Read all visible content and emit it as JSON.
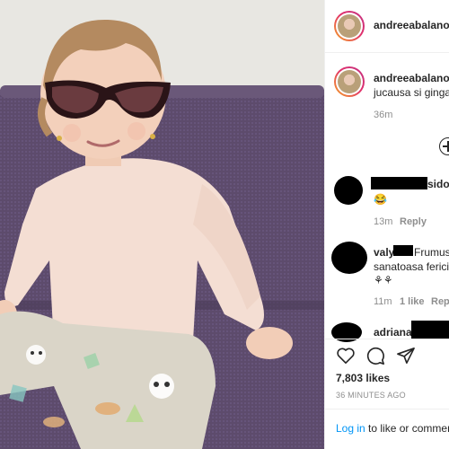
{
  "post": {
    "author": "andreeabalanoff",
    "caption_line": "jucausa si ginga",
    "caption_time": "36m",
    "likes": "7,803 likes",
    "time_ago": "36 MINUTES AGO",
    "login_link": "Log in",
    "login_suffix": " to like or comment"
  },
  "comments": [
    {
      "username_suffix": "sidor",
      "text": "😂",
      "time": "13m",
      "reply": "Reply"
    },
    {
      "username": "valy",
      "text_line1": "Frumuse",
      "text_line2": "sanatoasa fericita",
      "text_line3": "⚘⚘",
      "time": "11m",
      "likes": "1 like",
      "reply": "Reply"
    },
    {
      "username": "adrianac"
    }
  ],
  "colors": {
    "accent_link": "#0095f6",
    "sofa": "#5c4a6b",
    "wall": "#e7e6e1"
  },
  "icons": [
    "heart-icon",
    "comment-icon",
    "share-icon",
    "add-icon"
  ]
}
